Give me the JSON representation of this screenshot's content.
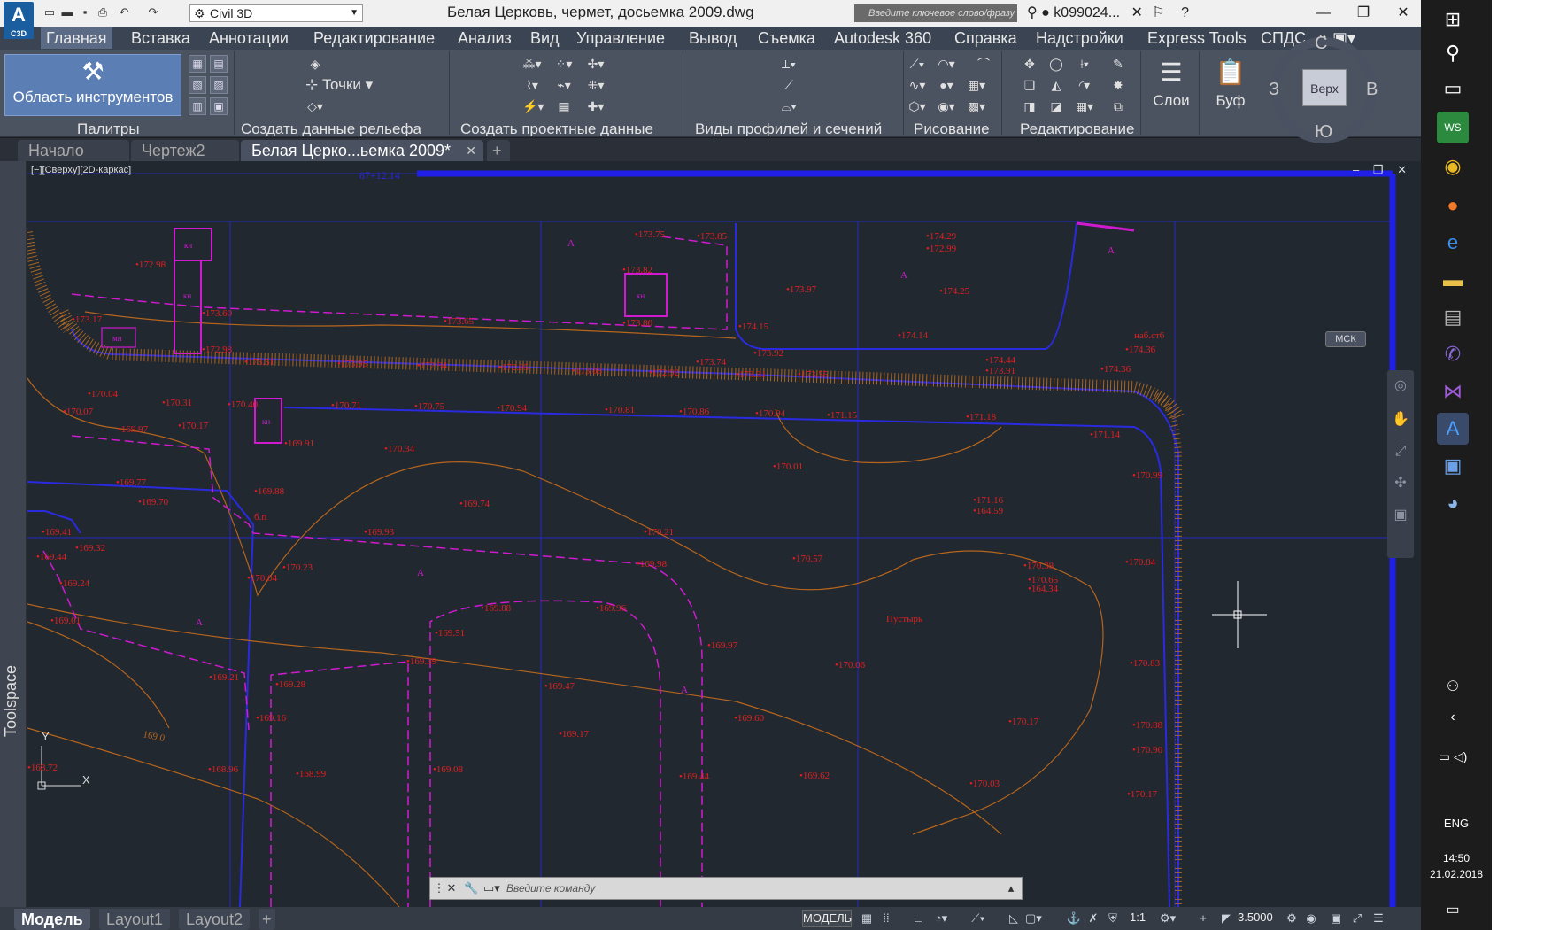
{
  "app": {
    "logo_text": "A",
    "logo_sub": "C3D",
    "workspace": "Civil 3D",
    "document_title": "Белая Церковь, чермет, досьемка 2009.dwg",
    "search_placeholder": "Введите ключевое слово/фразу",
    "user": "k099024...",
    "window_controls": {
      "minimize": "—",
      "maximize": "❐",
      "close": "✕"
    }
  },
  "menu": {
    "items": [
      "Главная",
      "Вставка",
      "Аннотации",
      "Редактирование",
      "Анализ",
      "Вид",
      "Управление",
      "Вывод",
      "Съемка",
      "Autodesk 360",
      "Справка",
      "Надстройки",
      "Express Tools",
      "СПДС"
    ],
    "active": 0
  },
  "ribbon": {
    "tool_palette_label": "Область инструментов",
    "points_label": "Точки",
    "panels": [
      "Палитры",
      "Создать данные рельефа",
      "Создать проектные данные",
      "Виды профилей и сечений",
      "Рисование",
      "Редактирование"
    ],
    "layers_label": "Слои",
    "clipboard_label": "Буф"
  },
  "doc_tabs": {
    "tabs": [
      "Начало",
      "Чертеж2",
      "Белая Церко...ьемка 2009*"
    ],
    "active": 2,
    "add": "+"
  },
  "viewport": {
    "label": "[−][Сверху][2D-каркас]",
    "controls": "– ❐ ✕",
    "toolspace_label": "Toolspace"
  },
  "viewcube": {
    "north": "С",
    "south": "Ю",
    "west": "З",
    "east": "В",
    "face": "Верх",
    "ucs": "МСК"
  },
  "drawing": {
    "elevations_red": [
      "172.98",
      "173.17",
      "173.60",
      "172.98",
      "173.51",
      "173.95",
      "172.94",
      "172.95",
      "173.08",
      "172.92",
      "173.74",
      "173.31",
      "173.55",
      "173.65",
      "173.80",
      "173.82",
      "173.75",
      "173.85",
      "173.97",
      "174.15",
      "173.92",
      "174.14",
      "174.25",
      "174.29",
      "172.99",
      "174.44",
      "173.91",
      "174.36",
      "174.36",
      "170.04",
      "170.07",
      "170.31",
      "170.40",
      "170.71",
      "170.75",
      "170.94",
      "170.81",
      "170.86",
      "170.94",
      "171.15",
      "171.18",
      "171.14",
      "169.97",
      "170.17",
      "169.91",
      "170.34",
      "170.01",
      "170.99",
      "169.77",
      "169.70",
      "169.88",
      "169.74",
      "171.16",
      "164.59",
      "169.41",
      "169.44",
      "169.32",
      "169.93",
      "170.21",
      "170.23",
      "170.04",
      "169.98",
      "170.57",
      "170.38",
      "170.65",
      "164.34",
      "170.84",
      "169.24",
      "169.01",
      "169.88",
      "169.96",
      "169.51",
      "169.97",
      "170.06",
      "170.83",
      "169.21",
      "169.28",
      "169.39",
      "169.47",
      "169.16",
      "169.17",
      "169.60",
      "170.17",
      "170.88",
      "170.90",
      "168.96",
      "168.99",
      "169.08",
      "169.44",
      "169.62",
      "170.03",
      "170.17",
      "168.72"
    ],
    "labels_magenta": [
      "кн",
      "кн",
      "мн",
      "кн",
      "кн"
    ],
    "labels_letter": [
      "А",
      "А",
      "А",
      "А",
      "А",
      "А"
    ],
    "pustyr": "Пустырь",
    "contour_label": "169.0",
    "misc": [
      "наб.ст6",
      "б.п",
      "87+12.14"
    ]
  },
  "command_line": {
    "placeholder": "Введите команду"
  },
  "status": {
    "layout_tabs": [
      "Модель",
      "Layout1",
      "Layout2"
    ],
    "active": 0,
    "model_btn": "МОДЕЛЬ",
    "annoscale": "1:1",
    "scale_value": "3.5000"
  },
  "taskbar": {
    "lang": "ENG",
    "time": "14:50",
    "date": "21.02.2018"
  },
  "colors": {
    "background": "#212830",
    "elevation": "#e02020",
    "magenta": "#d01ad0",
    "blue_line": "#2828e6",
    "contour": "#b5651d"
  }
}
